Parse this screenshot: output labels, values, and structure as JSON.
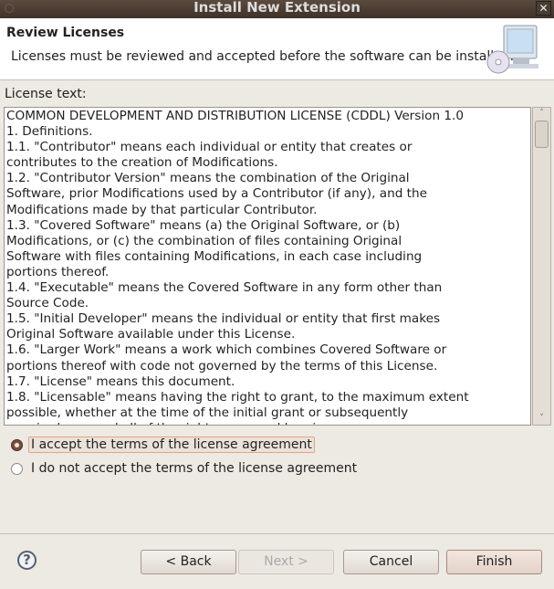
{
  "window": {
    "title": "Install New Extension"
  },
  "header": {
    "title": "Review Licenses",
    "description": "Licenses must be reviewed and accepted before the software can be installed.",
    "icon": "monitor-cd-icon"
  },
  "license": {
    "label": "License text:",
    "lines": [
      "COMMON DEVELOPMENT AND DISTRIBUTION LICENSE (CDDL) Version 1.0",
      "1. Definitions.",
      "1.1. \"Contributor\" means each individual or entity that creates or",
      "contributes to the creation of Modifications.",
      "1.2. \"Contributor Version\" means the combination of the Original",
      "Software, prior Modifications used by a Contributor (if any), and the",
      "Modifications made by that particular Contributor.",
      "1.3. \"Covered Software\" means (a) the Original Software, or (b)",
      "Modifications, or (c) the combination of files containing Original",
      "Software with files containing Modifications, in each case including",
      "portions thereof.",
      "1.4. \"Executable\" means the Covered Software in any form other than",
      "Source Code.",
      "1.5. \"Initial Developer\" means the individual or entity that first makes",
      "Original Software available under this License.",
      "1.6. \"Larger Work\" means a work which combines Covered Software or",
      "portions thereof with code not governed by the terms of this License.",
      "1.7. \"License\" means this document.",
      "1.8. \"Licensable\" means having the right to grant, to the maximum extent",
      "possible, whether at the time of the initial grant or subsequently",
      "acquired, any and all of the rights conveyed herein."
    ]
  },
  "options": {
    "accept": "I accept the terms of the license agreement",
    "decline": "I do not accept the terms of the license agreement",
    "selected": "accept"
  },
  "buttons": {
    "back": "< Back",
    "next": "Next >",
    "cancel": "Cancel",
    "finish": "Finish",
    "help": "?"
  }
}
